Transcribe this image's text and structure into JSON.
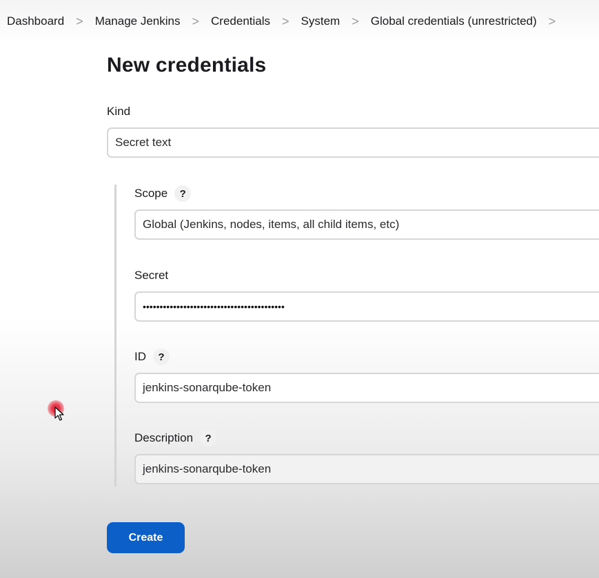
{
  "breadcrumb": {
    "items": [
      "Dashboard",
      "Manage Jenkins",
      "Credentials",
      "System",
      "Global credentials (unrestricted)"
    ],
    "separator": ">"
  },
  "page": {
    "title": "New credentials"
  },
  "form": {
    "kind": {
      "label": "Kind",
      "value": "Secret text"
    },
    "scope": {
      "label": "Scope",
      "help": "?",
      "value": "Global (Jenkins, nodes, items, all child items, etc)"
    },
    "secret": {
      "label": "Secret",
      "value": "••••••••••••••••••••••••••••••••••••••••••"
    },
    "id": {
      "label": "ID",
      "help": "?",
      "value": "jenkins-sonarqube-token"
    },
    "description": {
      "label": "Description",
      "help": "?",
      "value": "jenkins-sonarqube-token"
    },
    "create_label": "Create"
  },
  "colors": {
    "primary_button": "#0b5fc7",
    "cursor_highlight": "#e6283c"
  }
}
